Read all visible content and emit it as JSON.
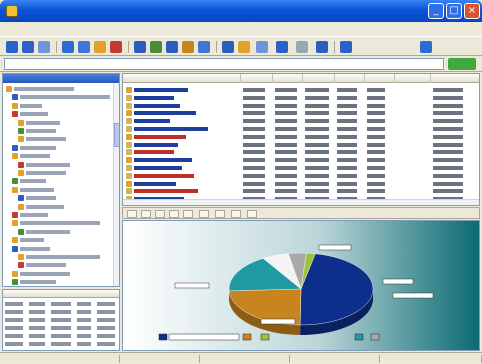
{
  "window": {
    "title": "",
    "minimize_label": "_",
    "maximize_label": "□",
    "close_label": "×"
  },
  "menu": [
    "",
    "",
    "",
    "",
    "",
    ""
  ],
  "address": {
    "value": "",
    "go_label": ""
  },
  "left_pane": {
    "title": "",
    "tree": [
      {
        "label": "",
        "icon": "folder-icon",
        "indent": 0,
        "w": 60
      },
      {
        "label": "",
        "icon": "folder-icon",
        "indent": 6,
        "w": 90
      },
      {
        "label": "",
        "icon": "folder-icon",
        "indent": 6,
        "w": 22
      },
      {
        "label": "",
        "icon": "folder-icon",
        "indent": 6,
        "w": 28
      },
      {
        "label": "",
        "icon": "folder-icon",
        "indent": 12,
        "w": 34
      },
      {
        "label": "",
        "icon": "folder-icon",
        "indent": 12,
        "w": 30
      },
      {
        "label": "",
        "icon": "folder-icon",
        "indent": 12,
        "w": 40
      },
      {
        "label": "",
        "icon": "folder-icon",
        "indent": 6,
        "w": 36
      },
      {
        "label": "",
        "icon": "folder-icon",
        "indent": 6,
        "w": 30
      },
      {
        "label": "",
        "icon": "folder-icon",
        "indent": 12,
        "w": 44
      },
      {
        "label": "",
        "icon": "folder-icon",
        "indent": 12,
        "w": 40
      },
      {
        "label": "",
        "icon": "folder-icon",
        "indent": 6,
        "w": 26
      },
      {
        "label": "",
        "icon": "folder-icon",
        "indent": 6,
        "w": 34
      },
      {
        "label": "",
        "icon": "folder-icon",
        "indent": 12,
        "w": 30
      },
      {
        "label": "",
        "icon": "folder-icon",
        "indent": 12,
        "w": 38
      },
      {
        "label": "",
        "icon": "folder-icon",
        "indent": 6,
        "w": 28
      },
      {
        "label": "",
        "icon": "folder-icon",
        "indent": 6,
        "w": 80
      },
      {
        "label": "",
        "icon": "folder-icon",
        "indent": 12,
        "w": 44
      },
      {
        "label": "",
        "icon": "folder-icon",
        "indent": 6,
        "w": 24
      },
      {
        "label": "",
        "icon": "folder-icon",
        "indent": 6,
        "w": 30
      },
      {
        "label": "",
        "icon": "folder-icon",
        "indent": 12,
        "w": 74
      },
      {
        "label": "",
        "icon": "folder-icon",
        "indent": 12,
        "w": 40
      },
      {
        "label": "",
        "icon": "folder-icon",
        "indent": 6,
        "w": 50
      },
      {
        "label": "",
        "icon": "folder-icon",
        "indent": 6,
        "w": 36
      }
    ]
  },
  "list": {
    "columns": [
      "",
      "",
      "",
      "",
      "",
      "",
      "",
      ""
    ],
    "rows": [
      {
        "color": "#1f3f9f"
      },
      {
        "color": "#1f3f9f"
      },
      {
        "color": "#1f3f9f"
      },
      {
        "color": "#1f3f9f"
      },
      {
        "color": "#1f3f9f"
      },
      {
        "color": "#1f3f9f"
      },
      {
        "color": "#c0302a"
      },
      {
        "color": "#1f3f9f"
      },
      {
        "color": "#c0302a"
      },
      {
        "color": "#1f3f9f"
      },
      {
        "color": "#1f3f9f"
      },
      {
        "color": "#c0302a"
      },
      {
        "color": "#1f3f9f"
      },
      {
        "color": "#c0302a"
      },
      {
        "color": "#1f3f9f"
      }
    ]
  },
  "colors": {
    "accent": "#0a53d6",
    "chart_blue": "#0d2e8a",
    "chart_orange": "#c8841e",
    "chart_teal": "#1f9aa0",
    "chart_white": "#f3f3f3",
    "chart_gray": "#a9a9a9",
    "chart_lime": "#9bc33c"
  },
  "chart_data": {
    "type": "pie",
    "slices": [
      {
        "color": "#0d2e8a",
        "value": 47
      },
      {
        "color": "#c8841e",
        "value": 24
      },
      {
        "color": "#1f9aa0",
        "value": 17
      },
      {
        "color": "#f3f3f3",
        "value": 6
      },
      {
        "color": "#a9a9a9",
        "value": 4
      },
      {
        "color": "#9bc33c",
        "value": 2
      }
    ],
    "legend_placement": "bottom"
  },
  "status": [
    "",
    "",
    "",
    "",
    ""
  ]
}
